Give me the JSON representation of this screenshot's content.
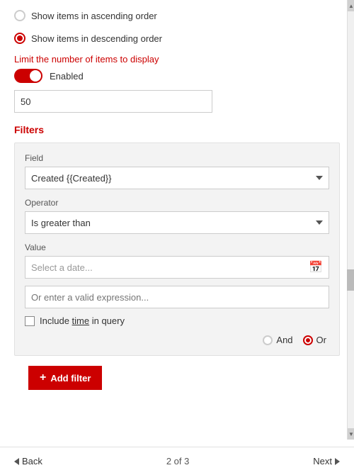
{
  "sort": {
    "ascending_label": "Show items in ascending order",
    "descending_label": "Show items in descending order",
    "descending_selected": true
  },
  "limit": {
    "label": "Limit the number of items to display",
    "toggle_label": "Enabled",
    "value": "50"
  },
  "filters": {
    "section_title": "Filters",
    "field_label": "Field",
    "field_value": "Created {{Created}}",
    "operator_label": "Operator",
    "operator_value": "Is greater than",
    "value_label": "Value",
    "date_placeholder": "Select a date...",
    "expression_placeholder": "Or enter a valid expression...",
    "checkbox_label": "Include ",
    "checkbox_label_underline": "time",
    "checkbox_label_suffix": " in query",
    "and_label": "And",
    "or_label": "Or"
  },
  "add_filter_btn": "+ Add filter",
  "nav": {
    "back_label": "Back",
    "page_info": "2 of 3",
    "next_label": "Next"
  }
}
